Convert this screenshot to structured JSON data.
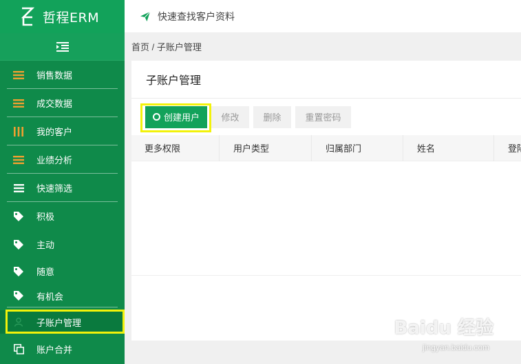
{
  "brand": {
    "name": "哲程ERM"
  },
  "topbar": {
    "search_text": "快速查找客户资料"
  },
  "sidebar": {
    "items": [
      {
        "label": "销售数据",
        "icon": "list-icon"
      },
      {
        "label": "成交数据",
        "icon": "list-icon"
      },
      {
        "label": "我的客户",
        "icon": "columns-icon"
      },
      {
        "label": "业绩分析",
        "icon": "list-icon"
      },
      {
        "label": "快速筛选",
        "icon": "menu-icon"
      },
      {
        "label": "积极",
        "icon": "tag-icon"
      },
      {
        "label": "主动",
        "icon": "tag-icon"
      },
      {
        "label": "随意",
        "icon": "tag-icon"
      },
      {
        "label": "有机会",
        "icon": "tag-icon"
      },
      {
        "label": "子账户管理",
        "icon": "user-icon"
      },
      {
        "label": "账户合并",
        "icon": "copy-icon"
      }
    ]
  },
  "breadcrumb": {
    "text": "首页 / 子账户管理"
  },
  "main": {
    "title": "子账户管理",
    "toolbar": {
      "create": "创建用户",
      "edit": "修改",
      "delete": "删除",
      "reset": "重置密码"
    },
    "columns": [
      "更多权限",
      "用户类型",
      "归属部门",
      "姓名",
      "登陆"
    ]
  },
  "watermark": {
    "main": "Baidu 经验",
    "sub": "jingyan.baidu.com"
  },
  "colors": {
    "brand_green": "#12a25a",
    "sidebar_green": "#0f8a4a",
    "highlight": "#f2f20a"
  }
}
